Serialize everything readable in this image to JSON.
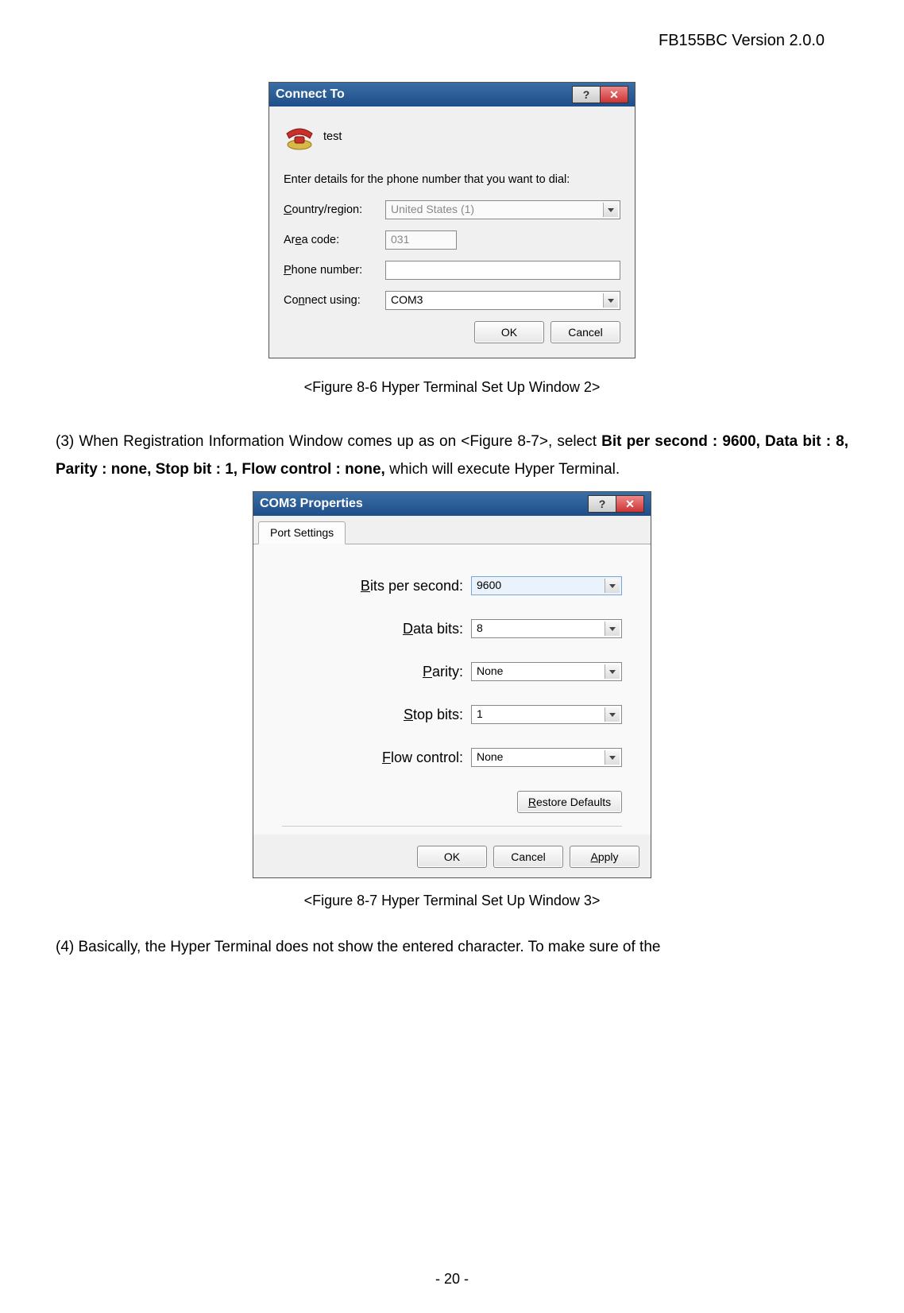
{
  "header": {
    "doc_version": "FB155BC Version 2.0.0"
  },
  "dialog1": {
    "title": "Connect To",
    "conn_name": "test",
    "instruction": "Enter details for the phone number that you want to dial:",
    "labels": {
      "country": "Country/region:",
      "area": "Area code:",
      "phone": "Phone number:",
      "connect": "Connect using:"
    },
    "values": {
      "country": "United States (1)",
      "area": "031",
      "phone": "",
      "connect": "COM3"
    },
    "ok": "OK",
    "cancel": "Cancel"
  },
  "caption1": "<Figure 8-6 Hyper Terminal Set Up Window 2>",
  "para3": {
    "pre": "(3) When Registration Information Window comes up as on <Figure 8-7>, select ",
    "bold": "Bit per second : 9600, Data bit : 8, Parity : none, Stop bit : 1, Flow control : none,",
    "post": " which will execute Hyper Terminal."
  },
  "dialog2": {
    "title": "COM3 Properties",
    "tab": "Port Settings",
    "labels": {
      "bps": "Bits per second:",
      "databits": "Data bits:",
      "parity": "Parity:",
      "stopbits": "Stop bits:",
      "flow": "Flow control:"
    },
    "values": {
      "bps": "9600",
      "databits": "8",
      "parity": "None",
      "stopbits": "1",
      "flow": "None"
    },
    "restore": "Restore Defaults",
    "ok": "OK",
    "cancel": "Cancel",
    "apply": "Apply"
  },
  "caption2": "<Figure 8-7 Hyper Terminal Set Up Window 3>",
  "para4": "(4) Basically, the Hyper Terminal does not show the entered character.  To make sure of the",
  "page_num": "- 20 -"
}
